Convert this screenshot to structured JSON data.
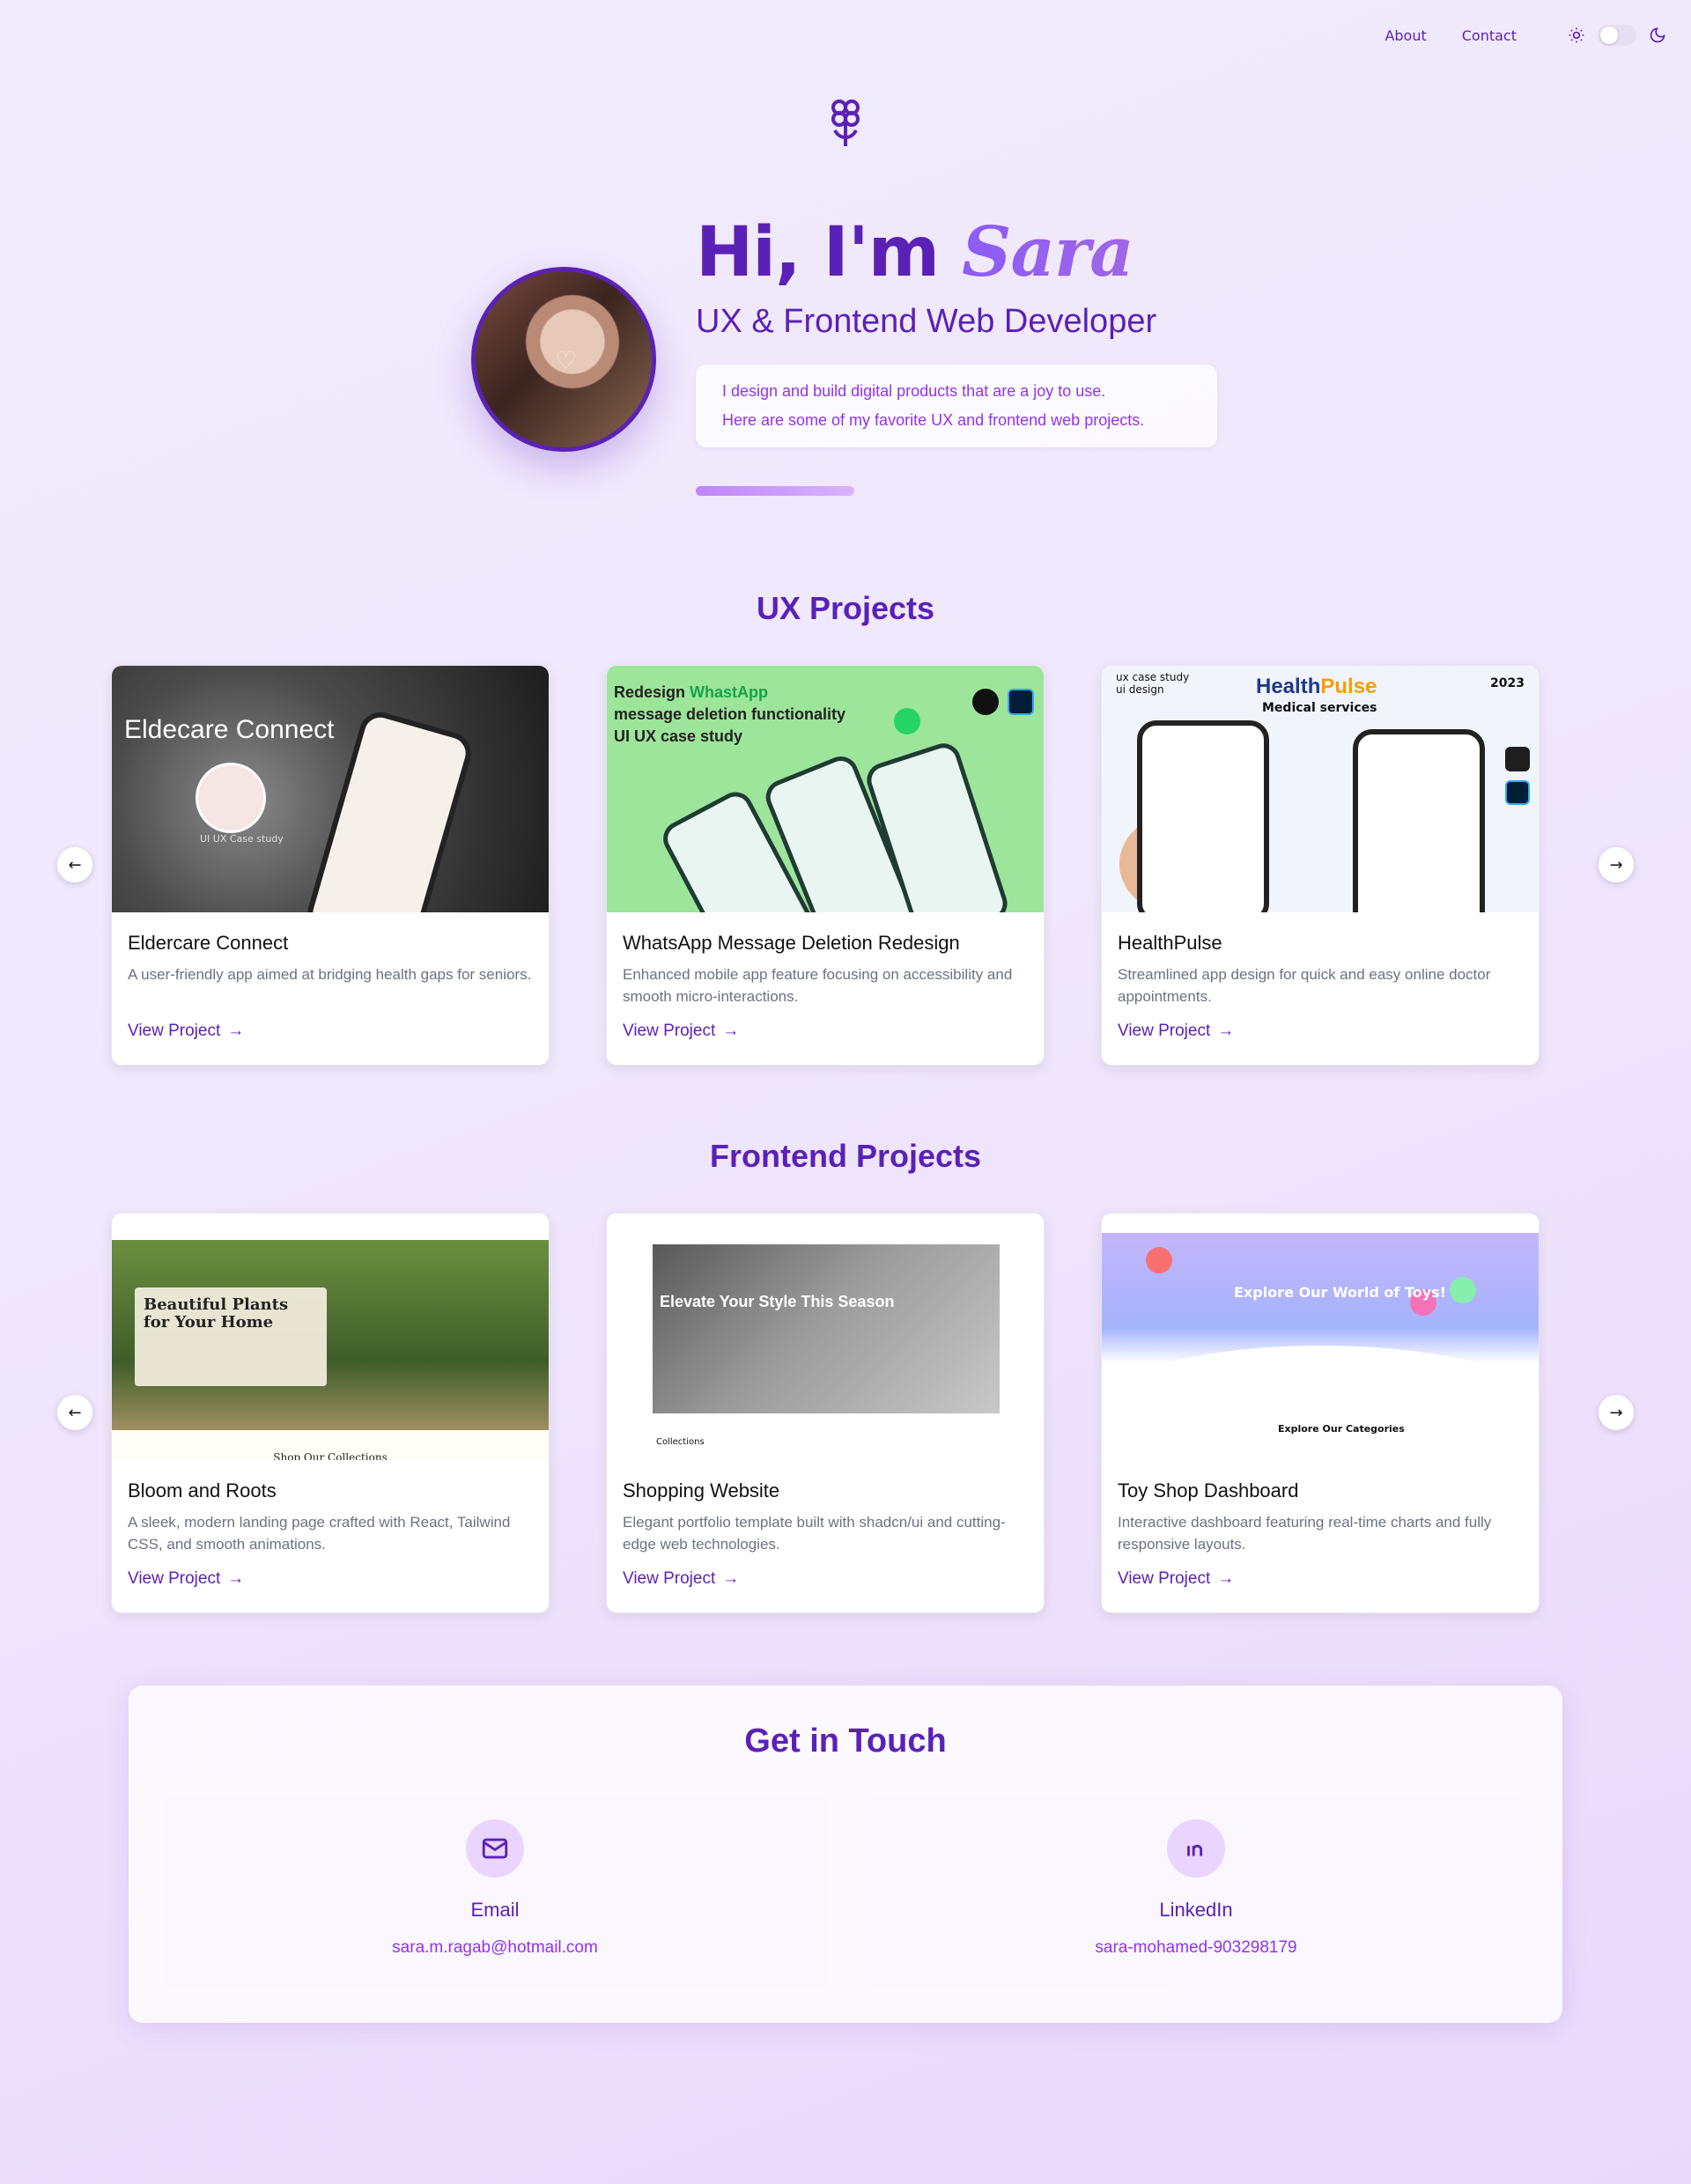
{
  "nav": {
    "about": "About",
    "contact": "Contact"
  },
  "theme": {
    "light_icon": "sun-icon",
    "dark_icon": "moon-icon",
    "toggle_state": "light"
  },
  "logo": {
    "icon": "flower-icon"
  },
  "hero": {
    "greeting": "Hi, I'm",
    "name": "Sara",
    "subtitle": "UX & Frontend Web Developer",
    "description_line1": "I design and build digital products that are a joy to use.",
    "description_line2": "Here are some of my favorite UX and frontend web projects."
  },
  "ux": {
    "title": "UX Projects",
    "prev_icon": "arrow-left-icon",
    "next_icon": "arrow-right-icon",
    "cards": [
      {
        "title": "Eldercare Connect",
        "desc": "A user-friendly app aimed at bridging health gaps for seniors.",
        "link": "View Project",
        "thumb_title": "Eldecare Connect",
        "thumb_caption": "UI UX Case study"
      },
      {
        "title": "WhatsApp Message Deletion Redesign",
        "desc": "Enhanced mobile app feature focusing on accessibility and smooth micro-interactions.",
        "link": "View Project",
        "thumb_line1a": "Redesign",
        "thumb_line1b": "WhastApp",
        "thumb_line2": "message deletion functionality",
        "thumb_line3": "UI UX case study"
      },
      {
        "title": "HealthPulse",
        "desc": "Streamlined app design for quick and easy online doctor appointments.",
        "link": "View Project",
        "thumb_tag1": "ux case study",
        "thumb_tag2": "ui design",
        "thumb_title_a": "Health",
        "thumb_title_b": "Pulse",
        "thumb_sub": "Medical services",
        "thumb_year": "2023"
      }
    ]
  },
  "frontend": {
    "title": "Frontend Projects",
    "prev_icon": "arrow-left-icon",
    "next_icon": "arrow-right-icon",
    "cards": [
      {
        "title": "Bloom and Roots",
        "desc": "A sleek, modern landing page crafted with React, Tailwind CSS, and smooth animations.",
        "link": "View Project",
        "thumb_heading": "Beautiful Plants for Your Home",
        "thumb_footer": "Shop Our Collections"
      },
      {
        "title": "Shopping Website",
        "desc": "Elegant portfolio template built with shadcn/ui and cutting-edge web technologies.",
        "link": "View Project",
        "thumb_heading": "Elevate Your Style This Season",
        "thumb_collections": "Collections"
      },
      {
        "title": "Toy Shop Dashboard",
        "desc": "Interactive dashboard featuring real-time charts and fully responsive layouts.",
        "link": "View Project",
        "thumb_heading": "Explore Our World of Toys!",
        "thumb_categories": "Explore Our Categories"
      }
    ]
  },
  "contact": {
    "title": "Get in Touch",
    "email": {
      "label": "Email",
      "value": "sara.m.ragab@hotmail.com",
      "icon": "mail-icon"
    },
    "linkedin": {
      "label": "LinkedIn",
      "value": "sara-mohamed-903298179",
      "icon": "linkedin-icon"
    }
  },
  "colors": {
    "accent": "#5b21b6",
    "accent_light": "#9b5de5",
    "text_muted": "#6b7280",
    "bg": "#f1ebfd"
  }
}
